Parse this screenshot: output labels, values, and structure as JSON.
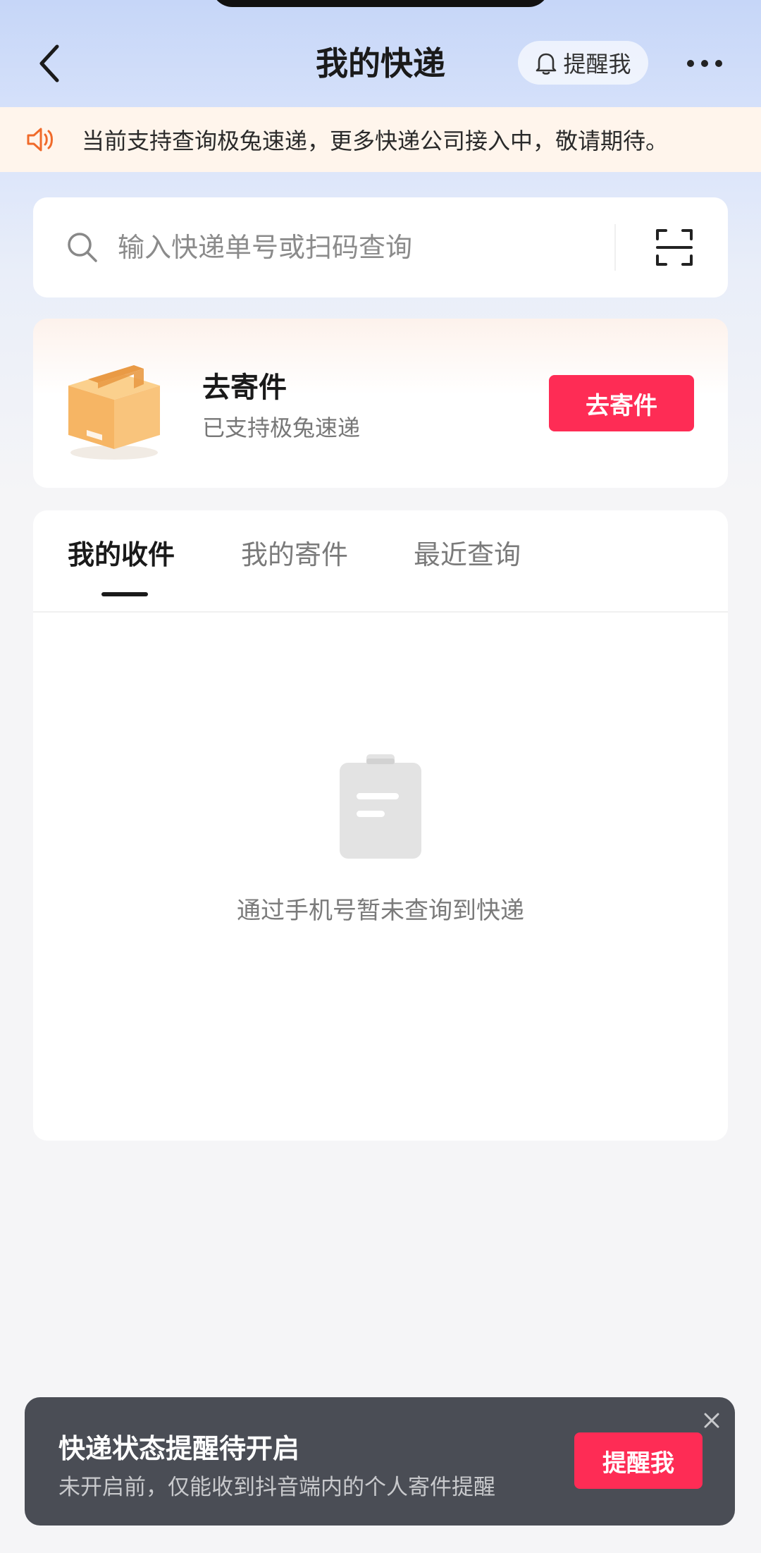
{
  "header": {
    "title": "我的快递",
    "remind_label": "提醒我"
  },
  "notice": {
    "text": "当前支持查询极兔速递，更多快递公司接入中，敬请期待。"
  },
  "search": {
    "placeholder": "输入快递单号或扫码查询"
  },
  "send_card": {
    "title": "去寄件",
    "subtitle": "已支持极兔速递",
    "button_label": "去寄件"
  },
  "tabs": [
    {
      "label": "我的收件",
      "active": true
    },
    {
      "label": "我的寄件",
      "active": false
    },
    {
      "label": "最近查询",
      "active": false
    }
  ],
  "empty_state": {
    "text": "通过手机号暂未查询到快递"
  },
  "bottom_banner": {
    "title": "快递状态提醒待开启",
    "subtitle": "未开启前，仅能收到抖音端内的个人寄件提醒",
    "button_label": "提醒我"
  },
  "colors": {
    "accent": "#fe2c55",
    "notice_bg": "#fff5ec",
    "notice_icon": "#f06a2a",
    "banner_bg": "#4a4d55"
  },
  "icons": [
    "back-arrow-icon",
    "bell-icon",
    "more-dots-icon",
    "speaker-icon",
    "search-icon",
    "scan-icon",
    "package-box-icon",
    "clipboard-icon",
    "close-icon"
  ]
}
